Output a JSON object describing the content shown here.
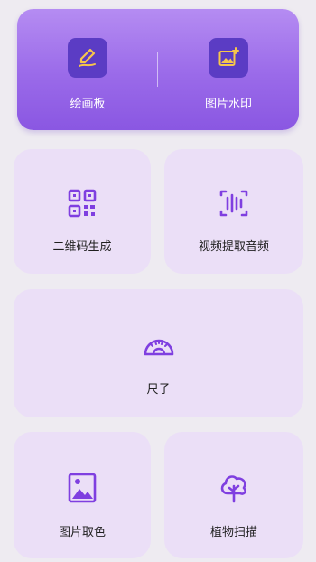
{
  "header_tools": [
    {
      "label": "绘画板",
      "icon": "drawing-board-icon"
    },
    {
      "label": "图片水印",
      "icon": "image-watermark-icon"
    }
  ],
  "tools": [
    {
      "label": "二维码生成",
      "icon": "qr-code-icon"
    },
    {
      "label": "视频提取音频",
      "icon": "audio-waveform-icon"
    },
    {
      "label": "尺子",
      "icon": "ruler-protractor-icon"
    },
    {
      "label": "图片取色",
      "icon": "image-icon"
    },
    {
      "label": "植物扫描",
      "icon": "tree-icon"
    }
  ],
  "colors": {
    "background": "#eeebf1",
    "header_gradient_top": "#b58cf2",
    "header_gradient_bottom": "#8a57e2",
    "header_icon_box": "#5b3cc4",
    "header_icon_accent": "#f7c64b",
    "tile_background": "#ebdff7",
    "tile_icon": "#7f3fe0"
  }
}
